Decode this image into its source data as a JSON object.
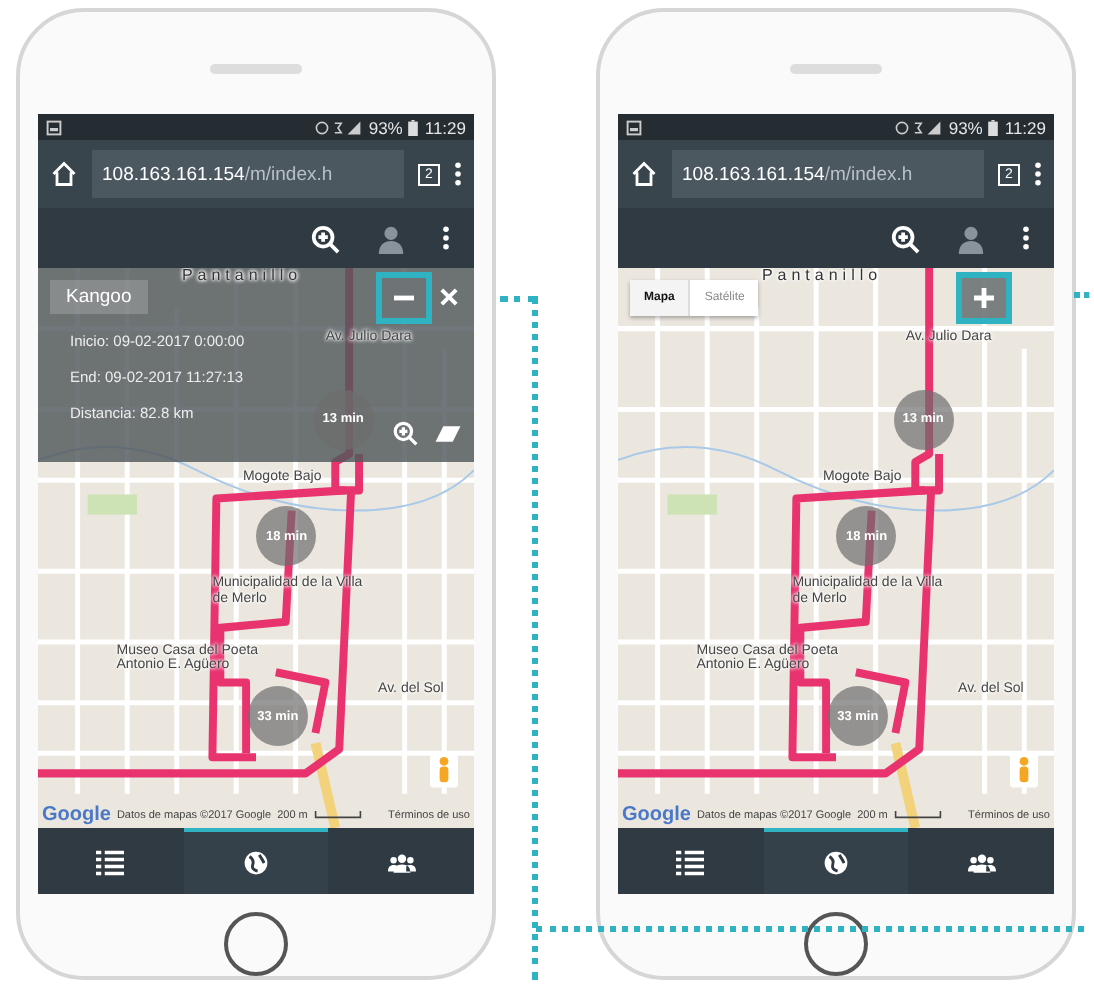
{
  "phones": [
    {
      "status_bar": {
        "battery": "93%",
        "time": "11:29"
      },
      "browser": {
        "url_host": "108.163.161.154",
        "url_path": "/m/index.h",
        "tab_count": "2"
      },
      "panel": {
        "expanded": true,
        "title": "Kangoo",
        "lines": [
          "Inicio: 09-02-2017 0:00:00",
          "End: 09-02-2017 11:27:13",
          "Distancia: 82.8 km"
        ]
      },
      "map_labels": [
        "Pantanillo",
        "Av. Julio Dara",
        "Mogote Bajo",
        "Municipalidad de la Villa de Merlo",
        "Museo Casa del Poeta Antonio E. Agüero",
        "Av. del Sol"
      ],
      "markers": [
        "13 min",
        "18 min",
        "33 min"
      ],
      "attribution": {
        "logo": "Google",
        "data": "Datos de mapas ©2017 Google",
        "scale": "200 m",
        "terms": "Términos de uso"
      },
      "nav": [
        {
          "kind": "list",
          "selected": false
        },
        {
          "kind": "globe",
          "selected": true
        },
        {
          "kind": "group",
          "selected": false
        }
      ]
    },
    {
      "status_bar": {
        "battery": "93%",
        "time": "11:29"
      },
      "browser": {
        "url_host": "108.163.161.154",
        "url_path": "/m/index.h",
        "tab_count": "2"
      },
      "panel": {
        "expanded": false,
        "map_types": [
          {
            "label": "Mapa",
            "selected": true
          },
          {
            "label": "Satélite",
            "selected": false
          }
        ]
      },
      "map_labels": [
        "Pantanillo",
        "Av. Julio Dara",
        "Mogote Bajo",
        "Municipalidad de la Villa de Merlo",
        "Museo Casa del Poeta Antonio E. Agüero",
        "Av. del Sol"
      ],
      "markers": [
        "13 min",
        "18 min",
        "33 min"
      ],
      "attribution": {
        "logo": "Google",
        "data": "Datos de mapas ©2017 Google",
        "scale": "200 m",
        "terms": "Términos de uso"
      },
      "nav": [
        {
          "kind": "list",
          "selected": false
        },
        {
          "kind": "globe",
          "selected": true
        },
        {
          "kind": "group",
          "selected": false
        }
      ]
    }
  ]
}
